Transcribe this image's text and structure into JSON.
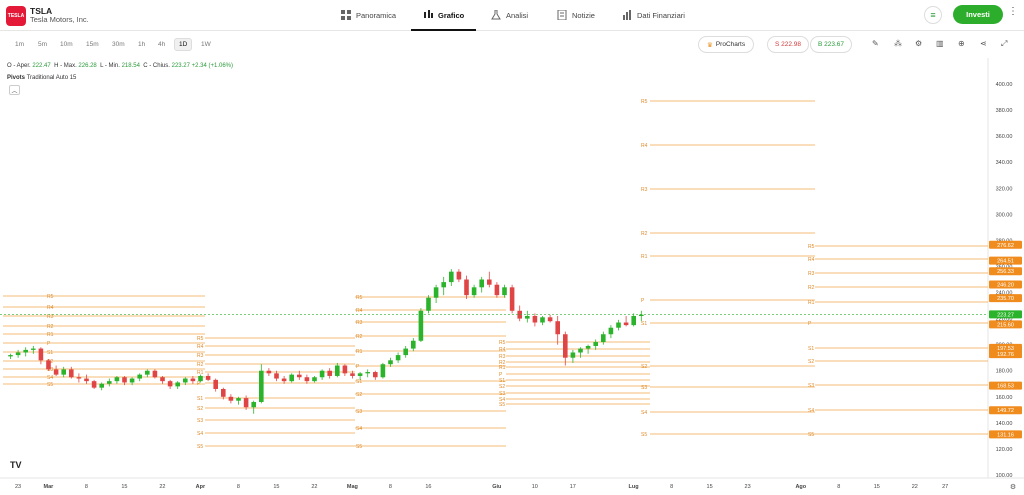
{
  "header": {
    "logo_text": "TESLA",
    "ticker": "TSLA",
    "company": "Tesla Motors, Inc.",
    "tabs": [
      {
        "label": "Panoramica",
        "icon": "grid-icon"
      },
      {
        "label": "Grafico",
        "icon": "candles-icon",
        "active": true
      },
      {
        "label": "Analisi",
        "icon": "flask-icon"
      },
      {
        "label": "Notizie",
        "icon": "document-icon"
      },
      {
        "label": "Dati Finanziari",
        "icon": "bar-chart-icon"
      }
    ],
    "invest_label": "Investi"
  },
  "toolbar": {
    "timeframes": [
      "1m",
      "5m",
      "10m",
      "15m",
      "30m",
      "1h",
      "4h",
      "1D",
      "1W"
    ],
    "active_timeframe": "1D",
    "prochart_label": "ProCharts",
    "sell_label": "S 222.98",
    "buy_label": "B 223.67"
  },
  "ohlc": {
    "open_label": "O - Aper.",
    "open": "222.47",
    "high_label": "H - Max.",
    "high": "226.28",
    "low_label": "L - Min.",
    "low": "218.54",
    "close_label": "C - Chius.",
    "close": "223.27",
    "change": "+2.34 (+1.06%)"
  },
  "indicator": {
    "name": "Pivots",
    "params": "Traditional Auto 15"
  },
  "chart_data": {
    "type": "candlestick",
    "series_name": "TSLA",
    "y_range": [
      100,
      400
    ],
    "y_ticks": [
      100,
      120,
      140,
      160,
      180,
      200,
      220,
      240,
      260,
      280,
      300,
      320,
      340,
      360,
      380,
      400
    ],
    "x_ticks": [
      {
        "label": "23",
        "idx": 0
      },
      {
        "label": "Mar",
        "idx": 4,
        "bold": true
      },
      {
        "label": "8",
        "idx": 9
      },
      {
        "label": "15",
        "idx": 14
      },
      {
        "label": "22",
        "idx": 19
      },
      {
        "label": "Apr",
        "idx": 24,
        "bold": true
      },
      {
        "label": "8",
        "idx": 29
      },
      {
        "label": "15",
        "idx": 34
      },
      {
        "label": "22",
        "idx": 39
      },
      {
        "label": "Mag",
        "idx": 44,
        "bold": true
      },
      {
        "label": "8",
        "idx": 49
      },
      {
        "label": "16",
        "idx": 54
      },
      {
        "label": "Giu",
        "idx": 63,
        "bold": true
      },
      {
        "label": "10",
        "idx": 68
      },
      {
        "label": "17",
        "idx": 73
      },
      {
        "label": "Lug",
        "idx": 81,
        "bold": true
      },
      {
        "label": "8",
        "idx": 86
      },
      {
        "label": "15",
        "idx": 91
      },
      {
        "label": "23",
        "idx": 96
      },
      {
        "label": "Ago",
        "idx": 103,
        "bold": true
      },
      {
        "label": "8",
        "idx": 108
      },
      {
        "label": "15",
        "idx": 113
      },
      {
        "label": "22",
        "idx": 118
      },
      {
        "label": "27",
        "idx": 122
      }
    ],
    "candles": [
      [
        191,
        193,
        189,
        192
      ],
      [
        192,
        196,
        190,
        194
      ],
      [
        194,
        198,
        191,
        196
      ],
      [
        196,
        199,
        193,
        197
      ],
      [
        197,
        198,
        185,
        188
      ],
      [
        188,
        189,
        180,
        181
      ],
      [
        181,
        184,
        176,
        177
      ],
      [
        177,
        183,
        175,
        181
      ],
      [
        181,
        183,
        174,
        175
      ],
      [
        175,
        178,
        171,
        174
      ],
      [
        174,
        177,
        170,
        172
      ],
      [
        172,
        173,
        166,
        167
      ],
      [
        167,
        171,
        165,
        170
      ],
      [
        170,
        174,
        168,
        172
      ],
      [
        172,
        176,
        170,
        175
      ],
      [
        175,
        176,
        169,
        171
      ],
      [
        171,
        175,
        169,
        174
      ],
      [
        174,
        178,
        172,
        177
      ],
      [
        177,
        181,
        175,
        180
      ],
      [
        180,
        181,
        174,
        175
      ],
      [
        175,
        176,
        170,
        172
      ],
      [
        172,
        173,
        166,
        168
      ],
      [
        168,
        172,
        166,
        171
      ],
      [
        171,
        175,
        169,
        174
      ],
      [
        174,
        176,
        170,
        172
      ],
      [
        172,
        177,
        171,
        176
      ],
      [
        176,
        178,
        172,
        173
      ],
      [
        173,
        174,
        164,
        166
      ],
      [
        166,
        167,
        158,
        160
      ],
      [
        160,
        162,
        155,
        157
      ],
      [
        157,
        160,
        154,
        159
      ],
      [
        159,
        161,
        150,
        152
      ],
      [
        152,
        157,
        147,
        156
      ],
      [
        156,
        185,
        155,
        180
      ],
      [
        180,
        182,
        176,
        178
      ],
      [
        178,
        180,
        172,
        174
      ],
      [
        174,
        176,
        170,
        172
      ],
      [
        172,
        178,
        171,
        177
      ],
      [
        177,
        180,
        173,
        175
      ],
      [
        175,
        177,
        170,
        172
      ],
      [
        172,
        176,
        171,
        175
      ],
      [
        175,
        181,
        173,
        180
      ],
      [
        180,
        182,
        174,
        176
      ],
      [
        176,
        186,
        175,
        184
      ],
      [
        184,
        185,
        176,
        178
      ],
      [
        178,
        180,
        174,
        176
      ],
      [
        176,
        179,
        173,
        178
      ],
      [
        178,
        181,
        175,
        179
      ],
      [
        179,
        180,
        173,
        175
      ],
      [
        175,
        186,
        174,
        185
      ],
      [
        185,
        190,
        183,
        188
      ],
      [
        188,
        194,
        186,
        192
      ],
      [
        192,
        199,
        190,
        197
      ],
      [
        197,
        205,
        195,
        203
      ],
      [
        203,
        228,
        202,
        226
      ],
      [
        226,
        238,
        224,
        236
      ],
      [
        236,
        246,
        232,
        244
      ],
      [
        244,
        252,
        238,
        248
      ],
      [
        248,
        258,
        245,
        256
      ],
      [
        256,
        258,
        248,
        250
      ],
      [
        250,
        253,
        235,
        238
      ],
      [
        238,
        246,
        236,
        244
      ],
      [
        244,
        252,
        240,
        250
      ],
      [
        250,
        256,
        244,
        246
      ],
      [
        246,
        248,
        236,
        238
      ],
      [
        238,
        246,
        236,
        244
      ],
      [
        244,
        246,
        224,
        226
      ],
      [
        226,
        230,
        218,
        220
      ],
      [
        220,
        226,
        217,
        222
      ],
      [
        222,
        224,
        214,
        217
      ],
      [
        217,
        222,
        215,
        221
      ],
      [
        221,
        223,
        217,
        218
      ],
      [
        218,
        222,
        200,
        208
      ],
      [
        208,
        210,
        184,
        190
      ],
      [
        190,
        196,
        186,
        194
      ],
      [
        194,
        198,
        190,
        197
      ],
      [
        197,
        200,
        193,
        199
      ],
      [
        199,
        204,
        196,
        202
      ],
      [
        202,
        210,
        200,
        208
      ],
      [
        208,
        215,
        205,
        213
      ],
      [
        213,
        219,
        211,
        217
      ],
      [
        217,
        222,
        214,
        215
      ],
      [
        215,
        224,
        214,
        222
      ],
      [
        222,
        226,
        218,
        223
      ]
    ]
  },
  "price_labels": [
    {
      "value": "276.62"
    },
    {
      "value": "264.51"
    },
    {
      "value": "256.33"
    },
    {
      "value": "246.20"
    },
    {
      "value": "235.70"
    },
    {
      "value": "223.27",
      "current": true
    },
    {
      "value": "215.60"
    },
    {
      "value": "197.53"
    },
    {
      "value": "192.76"
    },
    {
      "value": "168.53"
    },
    {
      "value": "149.72"
    },
    {
      "value": "131.16"
    }
  ],
  "pivot_labels": [
    "R5",
    "R4",
    "R3",
    "R2",
    "R1",
    "P",
    "S1",
    "S2",
    "S3",
    "S4",
    "S5"
  ],
  "colors": {
    "up": "#2bb32b",
    "down": "#e04545",
    "pivot": "#f0a84a",
    "pivot_label": "#e08a2a",
    "current_price": "#2bb32b",
    "price_tag": "#f08c1e"
  },
  "footer": {
    "tv_logo": "TV"
  }
}
